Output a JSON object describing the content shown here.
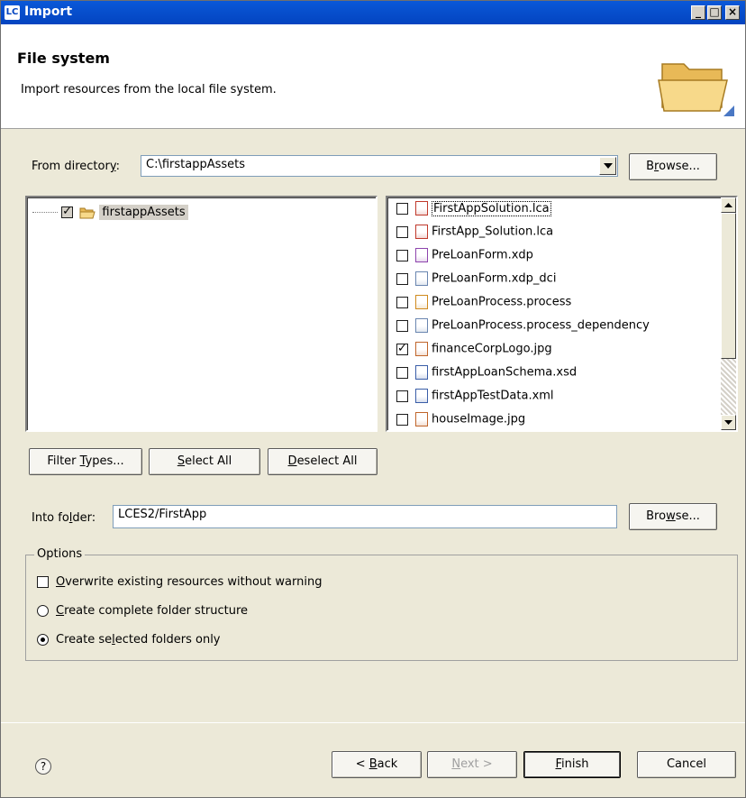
{
  "window": {
    "icon_text": "LC",
    "title": "Import",
    "controls": {
      "minimize": "_",
      "maximize": "□",
      "close": "×"
    }
  },
  "banner": {
    "title": "File system",
    "description": "Import resources from the local file system.",
    "icon": "folder-open-icon"
  },
  "from_directory": {
    "label_pre": "From director",
    "label_accel": "y",
    "label_post": ":",
    "value": "C:\\firstappAssets",
    "browse_pre": "B",
    "browse_accel": "r",
    "browse_post": "owse..."
  },
  "tree": {
    "items": [
      {
        "label": "firstappAssets",
        "checked": true,
        "greyed": true,
        "icon": "folder-open-icon"
      }
    ]
  },
  "files": [
    {
      "name": "FirstAppSolution.lca",
      "checked": false,
      "icon": "lca-file-icon"
    },
    {
      "name": "FirstApp_Solution.lca",
      "checked": false,
      "icon": "lca-file-icon"
    },
    {
      "name": "PreLoanForm.xdp",
      "checked": false,
      "icon": "form-file-icon"
    },
    {
      "name": "PreLoanForm.xdp_dci",
      "checked": false,
      "icon": "text-file-icon"
    },
    {
      "name": "PreLoanProcess.process",
      "checked": false,
      "icon": "process-file-icon"
    },
    {
      "name": "PreLoanProcess.process_dependency",
      "checked": false,
      "icon": "text-file-icon"
    },
    {
      "name": "financeCorpLogo.jpg",
      "checked": true,
      "icon": "image-file-icon"
    },
    {
      "name": "firstAppLoanSchema.xsd",
      "checked": false,
      "icon": "xml-file-icon"
    },
    {
      "name": "firstAppTestData.xml",
      "checked": false,
      "icon": "xml-file-icon"
    },
    {
      "name": "houseImage.jpg",
      "checked": false,
      "icon": "image-file-icon"
    }
  ],
  "selection_buttons": {
    "filter_pre": "Filter ",
    "filter_accel": "T",
    "filter_post": "ypes...",
    "select_accel": "S",
    "select_post": "elect All",
    "deselect_accel": "D",
    "deselect_post": "eselect All"
  },
  "into_folder": {
    "label_pre": "Into fo",
    "label_accel": "l",
    "label_post": "der:",
    "value": "LCES2/FirstApp",
    "browse_pre": "Bro",
    "browse_accel": "w",
    "browse_post": "se..."
  },
  "options": {
    "group_label": "Options",
    "overwrite": {
      "accel": "O",
      "rest": "verwrite existing resources without warning",
      "checked": false
    },
    "complete": {
      "accel": "C",
      "rest": "reate complete folder structure",
      "selected": false
    },
    "selected": {
      "pre": "Create se",
      "accel": "l",
      "post": "ected folders only",
      "selected": true
    }
  },
  "footer": {
    "help": "?",
    "back_pre": "< ",
    "back_accel": "B",
    "back_post": "ack",
    "next_accel": "N",
    "next_post": "ext >",
    "finish_accel": "F",
    "finish_post": "inish",
    "cancel": "Cancel"
  }
}
